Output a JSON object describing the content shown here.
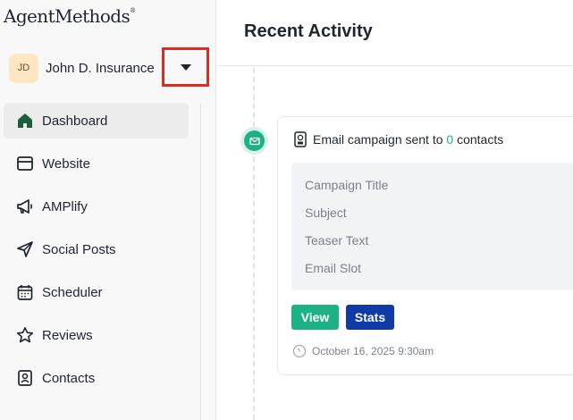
{
  "app": {
    "logo_text": "AgentMethods",
    "logo_mark": "®"
  },
  "account": {
    "initials": "JD",
    "name": "John D. Insurance"
  },
  "sidebar": {
    "items": [
      {
        "label": "Dashboard",
        "icon": "home-icon",
        "active": true
      },
      {
        "label": "Website",
        "icon": "browser-window-icon"
      },
      {
        "label": "AMPlify",
        "icon": "megaphone-icon"
      },
      {
        "label": "Social Posts",
        "icon": "send-icon"
      },
      {
        "label": "Scheduler",
        "icon": "calendar-icon"
      },
      {
        "label": "Reviews",
        "icon": "star-icon"
      },
      {
        "label": "Contacts",
        "icon": "contact-card-icon"
      }
    ]
  },
  "main": {
    "title": "Recent Activity",
    "activity": {
      "dot_icon": "mail-icon",
      "header_icon": "campaign-badge-icon",
      "headline_prefix": "Email campaign sent to ",
      "count": "0",
      "headline_suffix": " contacts",
      "details": [
        "Campaign Title",
        "Subject",
        "Teaser Text",
        "Email Slot"
      ],
      "view_label": "View",
      "stats_label": "Stats",
      "timestamp": "October 16, 2025 9:30am"
    }
  },
  "colors": {
    "accent": "#1db186",
    "primary": "#0f3aa8",
    "highlight_box": "#e02b20"
  }
}
